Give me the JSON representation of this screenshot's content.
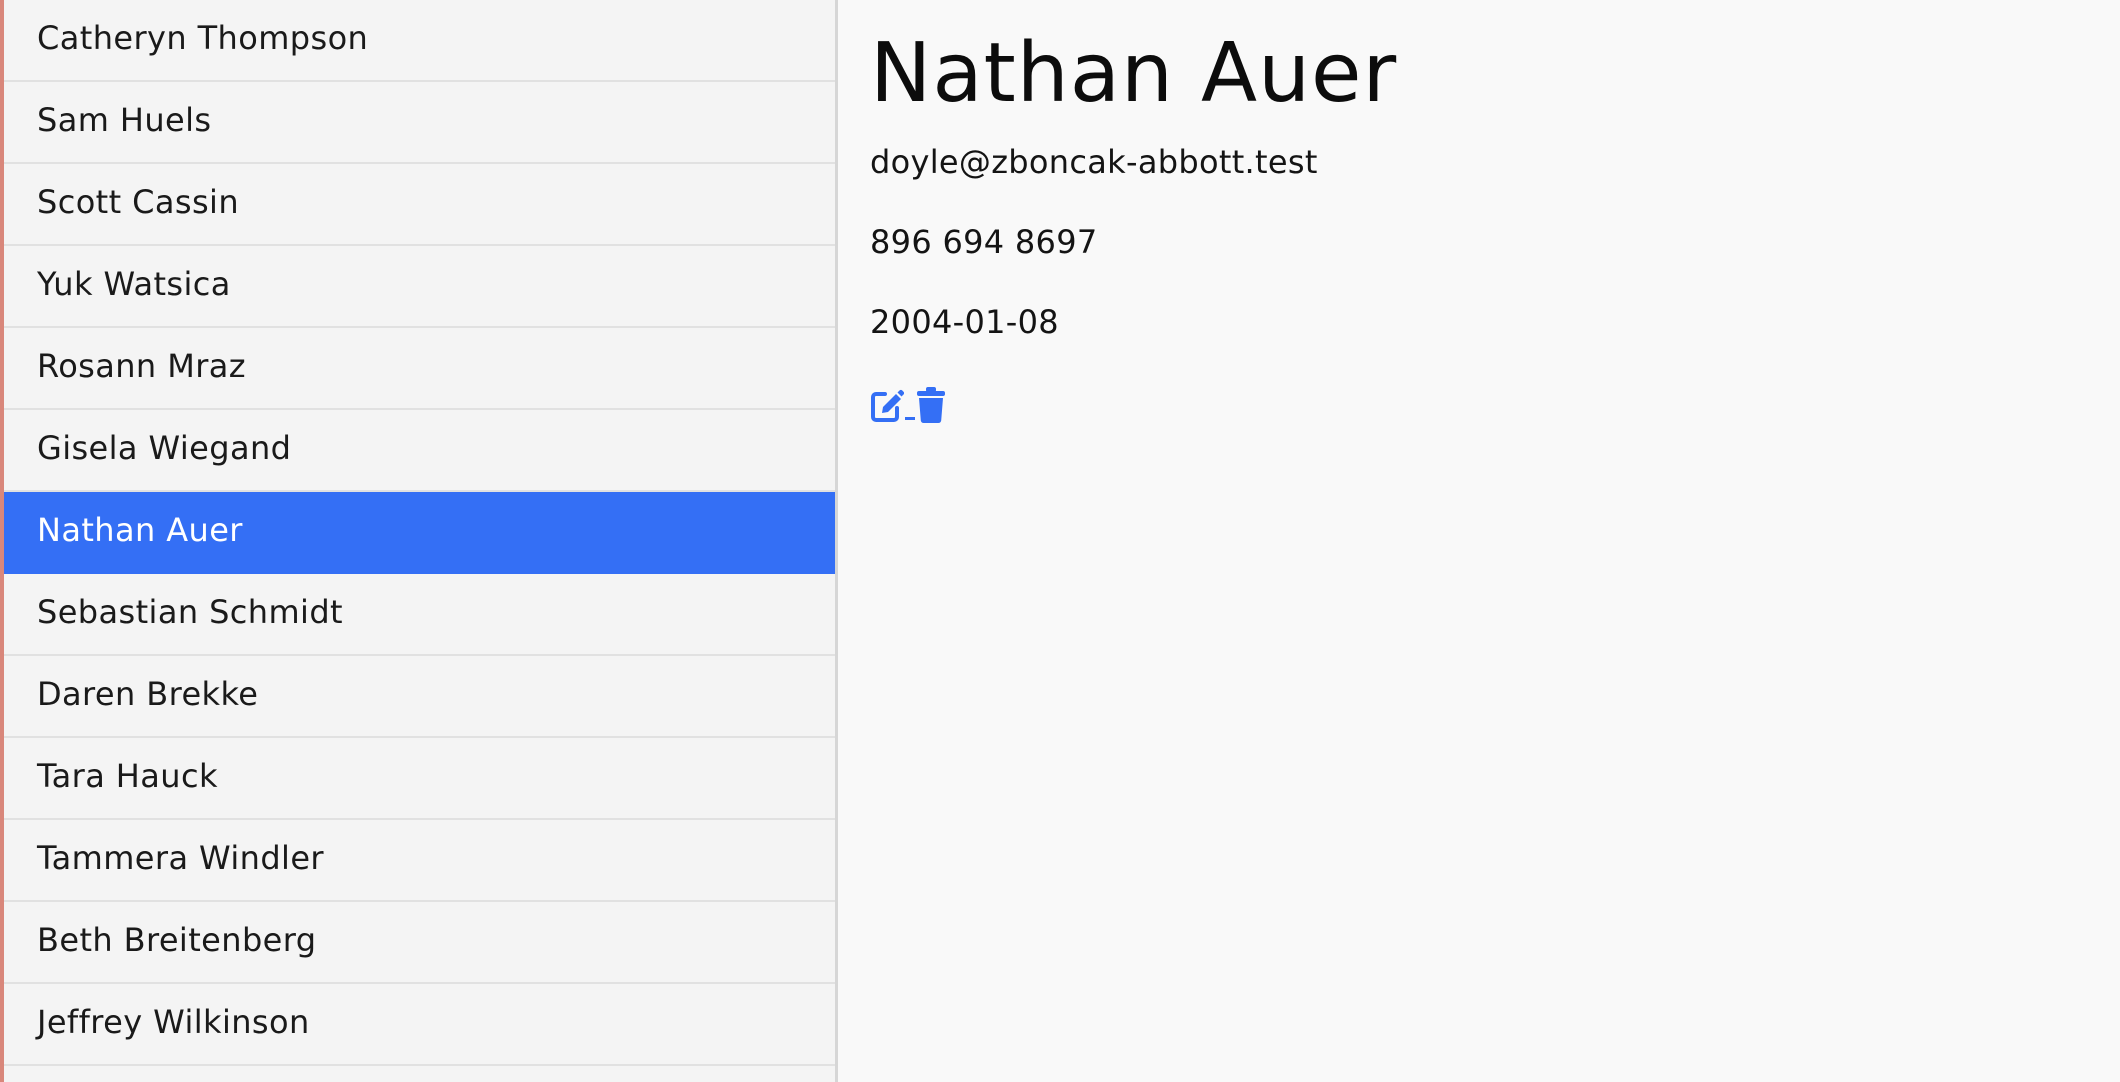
{
  "contacts": [
    {
      "name": "Catheryn Thompson"
    },
    {
      "name": "Sam Huels"
    },
    {
      "name": "Scott Cassin"
    },
    {
      "name": "Yuk Watsica"
    },
    {
      "name": "Rosann Mraz"
    },
    {
      "name": "Gisela Wiegand"
    },
    {
      "name": "Nathan Auer"
    },
    {
      "name": "Sebastian Schmidt"
    },
    {
      "name": "Daren Brekke"
    },
    {
      "name": "Tara Hauck"
    },
    {
      "name": "Tammera Windler"
    },
    {
      "name": "Beth Breitenberg"
    },
    {
      "name": "Jeffrey Wilkinson"
    }
  ],
  "selected_index": 6,
  "detail": {
    "name": "Nathan Auer",
    "email": "doyle@zboncak-abbott.test",
    "phone": "896 694 8697",
    "date": "2004-01-08"
  },
  "actions": {
    "edit_icon": "edit-icon",
    "delete_icon": "trash-icon"
  },
  "colors": {
    "accent": "#346ff5",
    "sidebar_bg": "#f4f4f4",
    "main_bg": "#f9f9f9",
    "left_edge": "#d9877b"
  }
}
